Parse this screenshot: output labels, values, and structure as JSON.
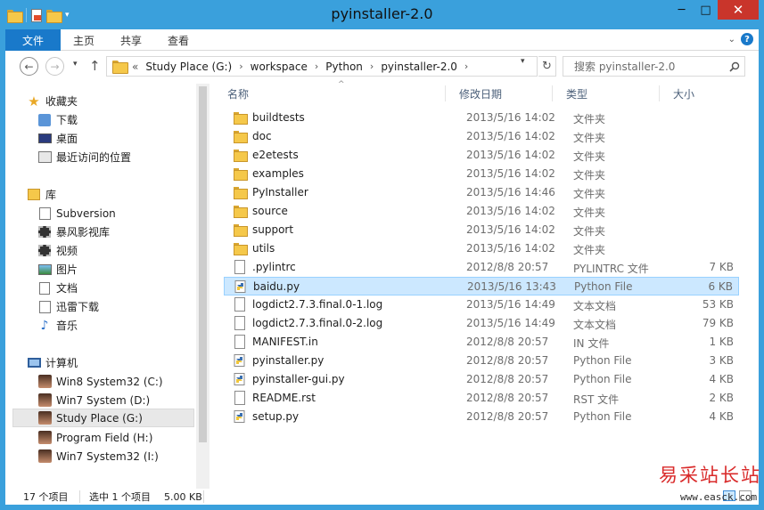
{
  "window": {
    "title": "pyinstaller-2.0",
    "controls": {
      "minimize": "─",
      "maximize": "□",
      "close": "✕"
    }
  },
  "ribbon": {
    "file_tab": "文件",
    "tabs": [
      "主页",
      "共享",
      "查看"
    ]
  },
  "nav": {
    "back": "←",
    "forward": "→",
    "up": "↑"
  },
  "address": {
    "prefix": "«",
    "crumbs": [
      "Study Place (G:)",
      "workspace",
      "Python",
      "pyinstaller-2.0"
    ]
  },
  "search": {
    "placeholder": "搜索 pyinstaller-2.0"
  },
  "navpane": {
    "favorites": {
      "label": "收藏夹",
      "items": [
        "下载",
        "桌面",
        "最近访问的位置"
      ]
    },
    "libraries": {
      "label": "库",
      "items": [
        "Subversion",
        "暴风影视库",
        "视频",
        "图片",
        "文档",
        "迅雷下载",
        "音乐"
      ]
    },
    "computer": {
      "label": "计算机",
      "items": [
        "Win8 System32 (C:)",
        "Win7 System (D:)",
        "Study Place (G:)",
        "Program Field (H:)",
        "Win7 System32 (I:)"
      ],
      "selected_index": 2
    }
  },
  "columns": {
    "name": "名称",
    "date": "修改日期",
    "type": "类型",
    "size": "大小"
  },
  "files": [
    {
      "name": "buildtests",
      "date": "2013/5/16 14:02",
      "type": "文件夹",
      "size": "",
      "icon": "folder"
    },
    {
      "name": "doc",
      "date": "2013/5/16 14:02",
      "type": "文件夹",
      "size": "",
      "icon": "folder"
    },
    {
      "name": "e2etests",
      "date": "2013/5/16 14:02",
      "type": "文件夹",
      "size": "",
      "icon": "folder"
    },
    {
      "name": "examples",
      "date": "2013/5/16 14:02",
      "type": "文件夹",
      "size": "",
      "icon": "folder"
    },
    {
      "name": "PyInstaller",
      "date": "2013/5/16 14:46",
      "type": "文件夹",
      "size": "",
      "icon": "folder"
    },
    {
      "name": "source",
      "date": "2013/5/16 14:02",
      "type": "文件夹",
      "size": "",
      "icon": "folder"
    },
    {
      "name": "support",
      "date": "2013/5/16 14:02",
      "type": "文件夹",
      "size": "",
      "icon": "folder"
    },
    {
      "name": "utils",
      "date": "2013/5/16 14:02",
      "type": "文件夹",
      "size": "",
      "icon": "folder"
    },
    {
      "name": ".pylintrc",
      "date": "2012/8/8 20:57",
      "type": "PYLINTRC 文件",
      "size": "7 KB",
      "icon": "file"
    },
    {
      "name": "baidu.py",
      "date": "2013/5/16 13:43",
      "type": "Python File",
      "size": "6 KB",
      "icon": "python",
      "selected": true
    },
    {
      "name": "logdict2.7.3.final.0-1.log",
      "date": "2013/5/16 14:49",
      "type": "文本文档",
      "size": "53 KB",
      "icon": "file"
    },
    {
      "name": "logdict2.7.3.final.0-2.log",
      "date": "2013/5/16 14:49",
      "type": "文本文档",
      "size": "79 KB",
      "icon": "file"
    },
    {
      "name": "MANIFEST.in",
      "date": "2012/8/8 20:57",
      "type": "IN 文件",
      "size": "1 KB",
      "icon": "file"
    },
    {
      "name": "pyinstaller.py",
      "date": "2012/8/8 20:57",
      "type": "Python File",
      "size": "3 KB",
      "icon": "python"
    },
    {
      "name": "pyinstaller-gui.py",
      "date": "2012/8/8 20:57",
      "type": "Python File",
      "size": "4 KB",
      "icon": "python"
    },
    {
      "name": "README.rst",
      "date": "2012/8/8 20:57",
      "type": "RST 文件",
      "size": "2 KB",
      "icon": "file"
    },
    {
      "name": "setup.py",
      "date": "2012/8/8 20:57",
      "type": "Python File",
      "size": "4 KB",
      "icon": "python"
    }
  ],
  "status": {
    "count": "17 个项目",
    "selection": "选中 1 个项目",
    "size": "5.00 KB"
  },
  "watermark": {
    "text": "易采站长站",
    "url": "www.easck.com"
  },
  "colors": {
    "titlebar": "#3aa0dc",
    "file_tab": "#1979ca",
    "selection": "#cce8ff",
    "close": "#c9352b"
  }
}
